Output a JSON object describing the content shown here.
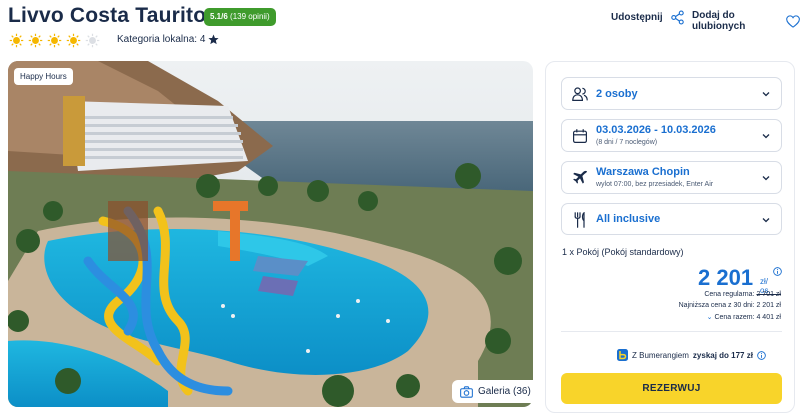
{
  "hotel": {
    "name": "Livvo Costa Taurito",
    "rating_score": "5.1/6",
    "rating_count": "(139 opinii)",
    "stars": 4,
    "category_label": "Kategoria lokalna: 4"
  },
  "actions": {
    "share_label": "Udostępnij",
    "favorite_label": "Dodaj do ulubionych"
  },
  "photo": {
    "badge": "Happy Hours",
    "gallery_label": "Galeria (36)"
  },
  "booking": {
    "travelers": "2 osoby",
    "dates": "03.03.2026 - 10.03.2026",
    "nights": "(8 dni / 7 noclegów)",
    "departure": "Warszawa Chopin",
    "flight_info": "wylot 07:00, bez przesiadek, Enter Air",
    "board": "All inclusive",
    "room": "1 x Pokój  (Pokój standardowy)",
    "price": "2 201",
    "currency_line1": "zł/",
    "currency_line2": "os.",
    "regular_label": "Cena regularna:",
    "regular_value": "2 701 zł",
    "lowest_label": "Najniższa cena z 30 dni:",
    "lowest_value": "2 201 zł",
    "total_label": "Cena razem:",
    "total_value": "4 401 zł",
    "bumerang_text": "Z Bumerangiem",
    "bumerang_bold": "zyskaj do 177 zł",
    "reserve_button": "REZERWUJ"
  },
  "colors": {
    "accent_blue": "#1a6fd0",
    "rating_green": "#3f9b2c",
    "star_yellow": "#f5b700",
    "button_yellow": "#f8d42a"
  }
}
